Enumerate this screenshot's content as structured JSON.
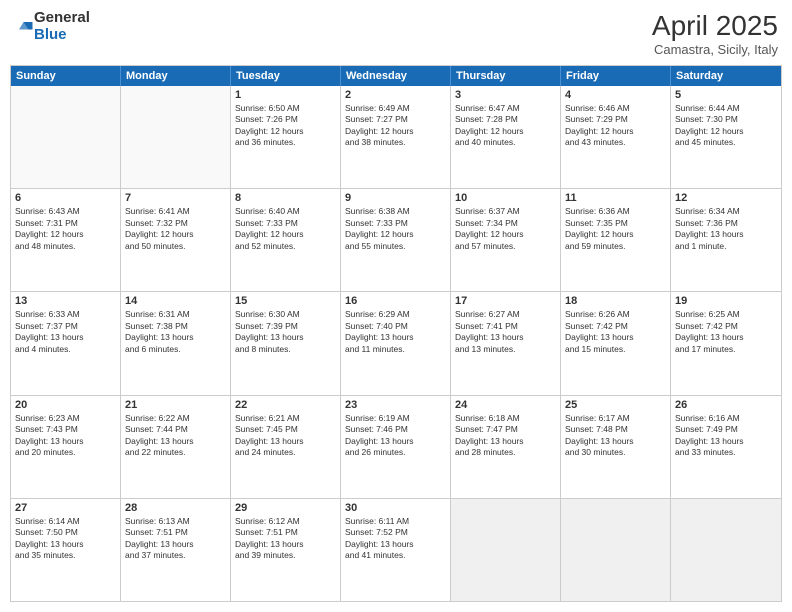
{
  "logo": {
    "general": "General",
    "blue": "Blue"
  },
  "header": {
    "month": "April 2025",
    "location": "Camastra, Sicily, Italy"
  },
  "weekdays": [
    "Sunday",
    "Monday",
    "Tuesday",
    "Wednesday",
    "Thursday",
    "Friday",
    "Saturday"
  ],
  "rows": [
    [
      {
        "day": "",
        "empty": true
      },
      {
        "day": "",
        "empty": true
      },
      {
        "day": "1",
        "line1": "Sunrise: 6:50 AM",
        "line2": "Sunset: 7:26 PM",
        "line3": "Daylight: 12 hours",
        "line4": "and 36 minutes."
      },
      {
        "day": "2",
        "line1": "Sunrise: 6:49 AM",
        "line2": "Sunset: 7:27 PM",
        "line3": "Daylight: 12 hours",
        "line4": "and 38 minutes."
      },
      {
        "day": "3",
        "line1": "Sunrise: 6:47 AM",
        "line2": "Sunset: 7:28 PM",
        "line3": "Daylight: 12 hours",
        "line4": "and 40 minutes."
      },
      {
        "day": "4",
        "line1": "Sunrise: 6:46 AM",
        "line2": "Sunset: 7:29 PM",
        "line3": "Daylight: 12 hours",
        "line4": "and 43 minutes."
      },
      {
        "day": "5",
        "line1": "Sunrise: 6:44 AM",
        "line2": "Sunset: 7:30 PM",
        "line3": "Daylight: 12 hours",
        "line4": "and 45 minutes."
      }
    ],
    [
      {
        "day": "6",
        "line1": "Sunrise: 6:43 AM",
        "line2": "Sunset: 7:31 PM",
        "line3": "Daylight: 12 hours",
        "line4": "and 48 minutes."
      },
      {
        "day": "7",
        "line1": "Sunrise: 6:41 AM",
        "line2": "Sunset: 7:32 PM",
        "line3": "Daylight: 12 hours",
        "line4": "and 50 minutes."
      },
      {
        "day": "8",
        "line1": "Sunrise: 6:40 AM",
        "line2": "Sunset: 7:33 PM",
        "line3": "Daylight: 12 hours",
        "line4": "and 52 minutes."
      },
      {
        "day": "9",
        "line1": "Sunrise: 6:38 AM",
        "line2": "Sunset: 7:33 PM",
        "line3": "Daylight: 12 hours",
        "line4": "and 55 minutes."
      },
      {
        "day": "10",
        "line1": "Sunrise: 6:37 AM",
        "line2": "Sunset: 7:34 PM",
        "line3": "Daylight: 12 hours",
        "line4": "and 57 minutes."
      },
      {
        "day": "11",
        "line1": "Sunrise: 6:36 AM",
        "line2": "Sunset: 7:35 PM",
        "line3": "Daylight: 12 hours",
        "line4": "and 59 minutes."
      },
      {
        "day": "12",
        "line1": "Sunrise: 6:34 AM",
        "line2": "Sunset: 7:36 PM",
        "line3": "Daylight: 13 hours",
        "line4": "and 1 minute."
      }
    ],
    [
      {
        "day": "13",
        "line1": "Sunrise: 6:33 AM",
        "line2": "Sunset: 7:37 PM",
        "line3": "Daylight: 13 hours",
        "line4": "and 4 minutes."
      },
      {
        "day": "14",
        "line1": "Sunrise: 6:31 AM",
        "line2": "Sunset: 7:38 PM",
        "line3": "Daylight: 13 hours",
        "line4": "and 6 minutes."
      },
      {
        "day": "15",
        "line1": "Sunrise: 6:30 AM",
        "line2": "Sunset: 7:39 PM",
        "line3": "Daylight: 13 hours",
        "line4": "and 8 minutes."
      },
      {
        "day": "16",
        "line1": "Sunrise: 6:29 AM",
        "line2": "Sunset: 7:40 PM",
        "line3": "Daylight: 13 hours",
        "line4": "and 11 minutes."
      },
      {
        "day": "17",
        "line1": "Sunrise: 6:27 AM",
        "line2": "Sunset: 7:41 PM",
        "line3": "Daylight: 13 hours",
        "line4": "and 13 minutes."
      },
      {
        "day": "18",
        "line1": "Sunrise: 6:26 AM",
        "line2": "Sunset: 7:42 PM",
        "line3": "Daylight: 13 hours",
        "line4": "and 15 minutes."
      },
      {
        "day": "19",
        "line1": "Sunrise: 6:25 AM",
        "line2": "Sunset: 7:42 PM",
        "line3": "Daylight: 13 hours",
        "line4": "and 17 minutes."
      }
    ],
    [
      {
        "day": "20",
        "line1": "Sunrise: 6:23 AM",
        "line2": "Sunset: 7:43 PM",
        "line3": "Daylight: 13 hours",
        "line4": "and 20 minutes."
      },
      {
        "day": "21",
        "line1": "Sunrise: 6:22 AM",
        "line2": "Sunset: 7:44 PM",
        "line3": "Daylight: 13 hours",
        "line4": "and 22 minutes."
      },
      {
        "day": "22",
        "line1": "Sunrise: 6:21 AM",
        "line2": "Sunset: 7:45 PM",
        "line3": "Daylight: 13 hours",
        "line4": "and 24 minutes."
      },
      {
        "day": "23",
        "line1": "Sunrise: 6:19 AM",
        "line2": "Sunset: 7:46 PM",
        "line3": "Daylight: 13 hours",
        "line4": "and 26 minutes."
      },
      {
        "day": "24",
        "line1": "Sunrise: 6:18 AM",
        "line2": "Sunset: 7:47 PM",
        "line3": "Daylight: 13 hours",
        "line4": "and 28 minutes."
      },
      {
        "day": "25",
        "line1": "Sunrise: 6:17 AM",
        "line2": "Sunset: 7:48 PM",
        "line3": "Daylight: 13 hours",
        "line4": "and 30 minutes."
      },
      {
        "day": "26",
        "line1": "Sunrise: 6:16 AM",
        "line2": "Sunset: 7:49 PM",
        "line3": "Daylight: 13 hours",
        "line4": "and 33 minutes."
      }
    ],
    [
      {
        "day": "27",
        "line1": "Sunrise: 6:14 AM",
        "line2": "Sunset: 7:50 PM",
        "line3": "Daylight: 13 hours",
        "line4": "and 35 minutes."
      },
      {
        "day": "28",
        "line1": "Sunrise: 6:13 AM",
        "line2": "Sunset: 7:51 PM",
        "line3": "Daylight: 13 hours",
        "line4": "and 37 minutes."
      },
      {
        "day": "29",
        "line1": "Sunrise: 6:12 AM",
        "line2": "Sunset: 7:51 PM",
        "line3": "Daylight: 13 hours",
        "line4": "and 39 minutes."
      },
      {
        "day": "30",
        "line1": "Sunrise: 6:11 AM",
        "line2": "Sunset: 7:52 PM",
        "line3": "Daylight: 13 hours",
        "line4": "and 41 minutes."
      },
      {
        "day": "",
        "empty": true
      },
      {
        "day": "",
        "empty": true
      },
      {
        "day": "",
        "empty": true
      }
    ]
  ]
}
